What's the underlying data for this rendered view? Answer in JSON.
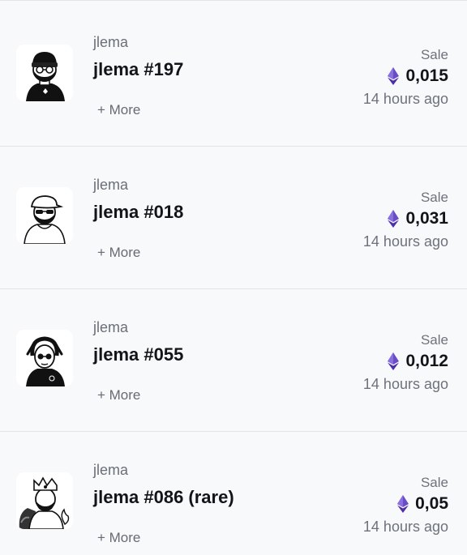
{
  "feed": {
    "items": [
      {
        "avatar_icon": "nft-beanie-glasses-avatar-icon",
        "collection": "jlema",
        "title": "jlema #197",
        "more_label": "+ More",
        "type_label": "Sale",
        "currency_icon": "ethereum-icon",
        "price": "0,015",
        "time": "14 hours ago"
      },
      {
        "avatar_icon": "nft-flat-cap-avatar-icon",
        "collection": "jlema",
        "title": "jlema #018",
        "more_label": "+ More",
        "type_label": "Sale",
        "currency_icon": "ethereum-icon",
        "price": "0,031",
        "time": "14 hours ago"
      },
      {
        "avatar_icon": "nft-dreadlocks-avatar-icon",
        "collection": "jlema",
        "title": "jlema #055",
        "more_label": "+ More",
        "type_label": "Sale",
        "currency_icon": "ethereum-icon",
        "price": "0,012",
        "time": "14 hours ago"
      },
      {
        "avatar_icon": "nft-crowned-king-avatar-icon",
        "collection": "jlema",
        "title": "jlema #086 (rare)",
        "more_label": "+ More",
        "type_label": "Sale",
        "currency_icon": "ethereum-icon",
        "price": "0,05",
        "time": "14 hours ago"
      }
    ],
    "colors": {
      "background": "#f8f9fb",
      "divider": "#e3e5e9",
      "ethereum_purple": "#6b4cc7"
    }
  }
}
